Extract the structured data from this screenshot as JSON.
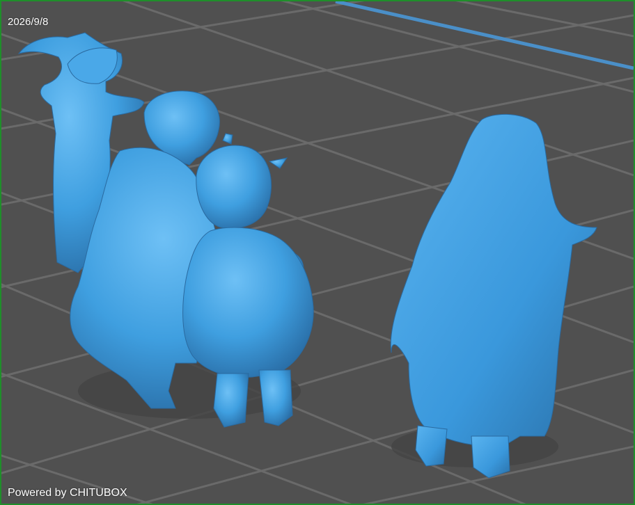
{
  "viewport": {
    "date": "2026/9/8",
    "powered_by": "Powered by CHITUBOX"
  },
  "scene": {
    "models": [
      {
        "icon": "witch-figure-icon"
      },
      {
        "icon": "adult-hugging-child-figure-icon"
      },
      {
        "icon": "pumpkin-costume-child-figure-icon"
      },
      {
        "icon": "ghost-costume-child-figure-icon"
      }
    ]
  },
  "colors": {
    "build_plate": "#505050",
    "grid_line": "#6a6a6a",
    "model": "#3f9fe0",
    "model_shadow": "#2b78b4",
    "frame_border": "#1f8f2a",
    "axis_line": "#4a8fc8"
  }
}
